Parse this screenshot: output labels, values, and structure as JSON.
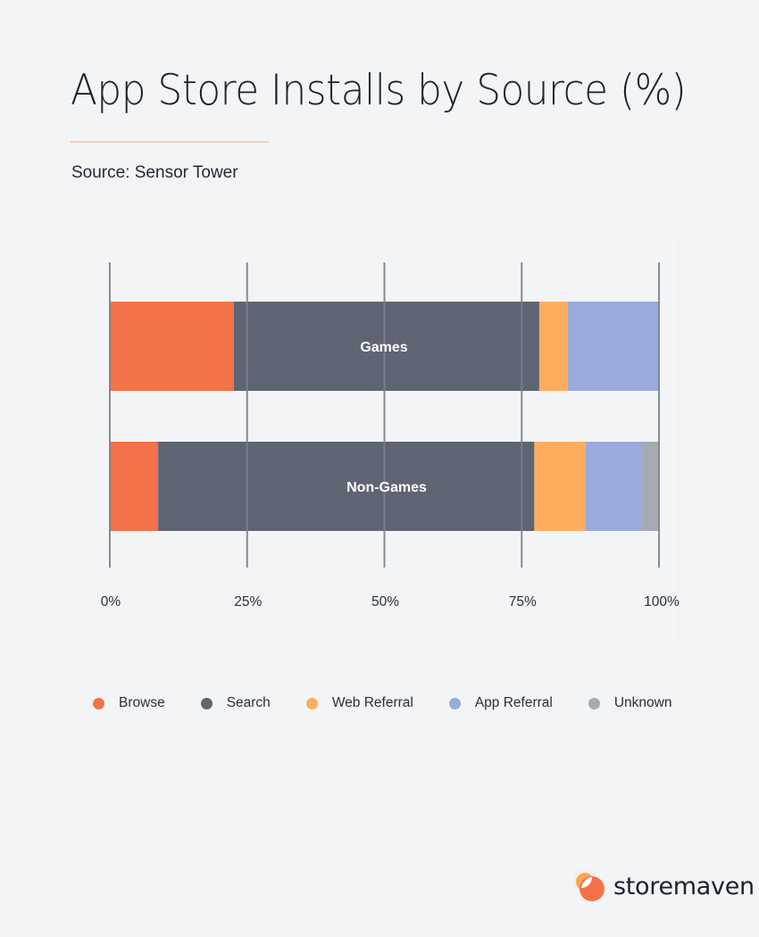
{
  "header": {
    "title": "App Store Installs by Source (%)",
    "subtitle": "Source: Sensor Tower"
  },
  "chart_data": {
    "type": "bar",
    "orientation": "horizontal",
    "stacked": true,
    "title": "App Store Installs by Source (%)",
    "subtitle": "Source: Sensor Tower",
    "categories": [
      "Games",
      "Non-Games"
    ],
    "series": [
      {
        "name": "Browse",
        "color": "#f37247",
        "values": [
          22.6,
          8.8
        ]
      },
      {
        "name": "Search",
        "color": "#5f6472",
        "values": [
          55.6,
          68.5
        ]
      },
      {
        "name": "Web Referral",
        "color": "#fead5f",
        "values": [
          5.2,
          9.3
        ]
      },
      {
        "name": "App Referral",
        "color": "#9aaadc",
        "values": [
          16.6,
          10.3
        ]
      },
      {
        "name": "Unknown",
        "color": "#a6aab3",
        "values": [
          0,
          3.1
        ]
      }
    ],
    "xlabel": "",
    "ylabel": "",
    "xlim": [
      0,
      100
    ],
    "xticks": [
      "0%",
      "25%",
      "50%",
      "75%",
      "100%"
    ],
    "xtick_values": [
      0,
      25,
      50,
      75,
      100
    ],
    "grid": true,
    "legend_position": "bottom"
  },
  "colors": {
    "background": "#f3f4f6",
    "accent_rule": "#f7cfb4",
    "gridline": "#7d7f88",
    "bar_label": "#ffffff"
  },
  "legend": [
    {
      "label": "Browse",
      "color": "#f37247"
    },
    {
      "label": "Search",
      "color": "#5f6472"
    },
    {
      "label": "Web Referral",
      "color": "#fead5f"
    },
    {
      "label": "App Referral",
      "color": "#9aaadc"
    },
    {
      "label": "Unknown",
      "color": "#a6aab3"
    }
  ],
  "brand": {
    "name": "storemaven",
    "logo_icon": "storemaven-logo-icon"
  }
}
